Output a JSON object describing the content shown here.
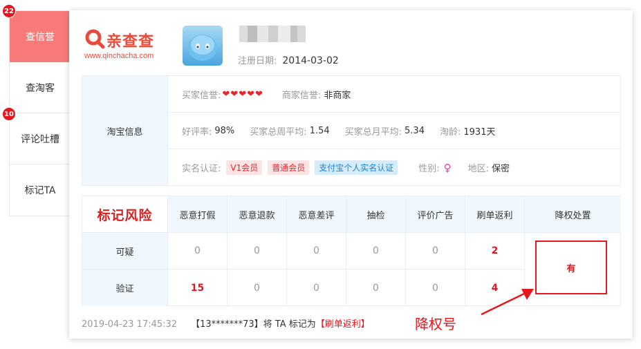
{
  "sidebar": {
    "items": [
      {
        "label": "查信誉",
        "badge": "22"
      },
      {
        "label": "查淘客",
        "badge": ""
      },
      {
        "label": "评论吐槽",
        "badge": "10"
      },
      {
        "label": "标记TA",
        "badge": ""
      }
    ]
  },
  "logo": {
    "name": "亲查查",
    "url": "www.qinchacha.com"
  },
  "profile": {
    "reg_label": "注册日期:",
    "reg_date": "2014-03-02"
  },
  "taobao_info": {
    "label": "淘宝信息",
    "buyer_credit_label": "买家信誉:",
    "buyer_credit_hearts": 5,
    "seller_credit_label": "商家信誉:",
    "seller_credit_value": "非商家",
    "good_rate_label": "好评率:",
    "good_rate_value": "98%",
    "week_avg_label": "买家总周平均:",
    "week_avg_value": "1.54",
    "month_avg_label": "买家总月平均:",
    "month_avg_value": "5.34",
    "age_label": "淘龄:",
    "age_value": "1931天",
    "realname_label": "实名认证:",
    "tags": [
      "V1会员",
      "普通会员",
      "支付宝个人实名认证"
    ],
    "gender_label": "性别:",
    "gender_symbol": "♀",
    "region_label": "地区:",
    "region_value": "保密"
  },
  "risk": {
    "title": "标记风险",
    "columns": [
      "恶意打假",
      "恶意退款",
      "恶意差评",
      "抽检",
      "评价广告",
      "刷单返利",
      "降权处置"
    ],
    "rows": [
      {
        "label": "可疑",
        "values": [
          "0",
          "0",
          "0",
          "0",
          "0",
          "2"
        ]
      },
      {
        "label": "验证",
        "values": [
          "15",
          "0",
          "0",
          "0",
          "0",
          "4"
        ]
      }
    ],
    "penalty": "有"
  },
  "footer": {
    "timestamp": "2019-04-23 17:45:32",
    "who": "【13*******73】将 TA 标记为",
    "mark": "【刷单返利】"
  },
  "annotation": "降权号",
  "colors": {
    "accent": "#e5161d",
    "active_tab": "#f87a78",
    "header_bg": "#f0f8fd"
  }
}
